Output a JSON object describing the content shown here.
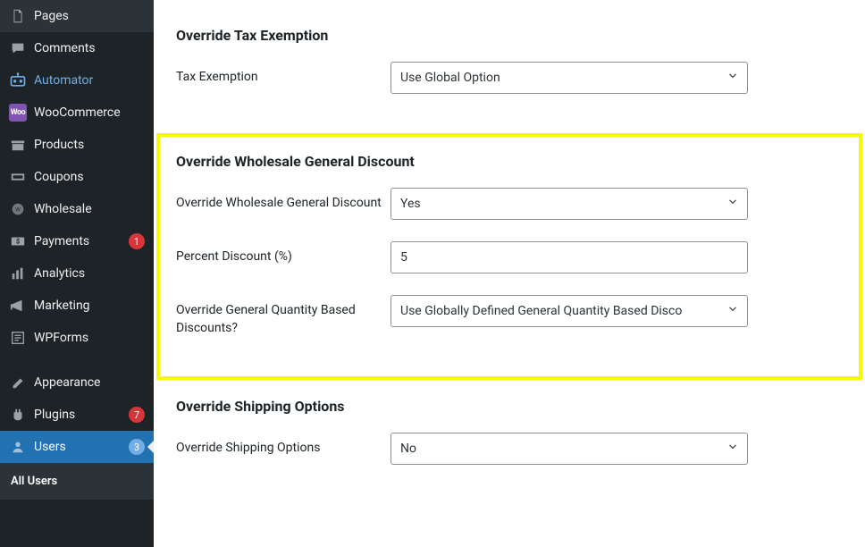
{
  "sidebar": {
    "items": [
      {
        "label": "Pages",
        "icon": "page"
      },
      {
        "label": "Comments",
        "icon": "comment"
      },
      {
        "label": "Automator",
        "icon": "automator",
        "highlight": true
      },
      {
        "label": "WooCommerce",
        "icon": "woo",
        "woo": true
      },
      {
        "label": "Products",
        "icon": "products"
      },
      {
        "label": "Coupons",
        "icon": "coupons"
      },
      {
        "label": "Wholesale",
        "icon": "wholesale"
      },
      {
        "label": "Payments",
        "icon": "payments",
        "badge": "1",
        "badgeColor": "red"
      },
      {
        "label": "Analytics",
        "icon": "analytics"
      },
      {
        "label": "Marketing",
        "icon": "marketing"
      },
      {
        "label": "WPForms",
        "icon": "wpforms"
      },
      {
        "label": "Appearance",
        "icon": "appearance"
      },
      {
        "label": "Plugins",
        "icon": "plugins",
        "badge": "7",
        "badgeColor": "red"
      },
      {
        "label": "Users",
        "icon": "users",
        "badge": "3",
        "badgeColor": "blue",
        "active": true
      }
    ],
    "submenu": {
      "items": [
        {
          "label": "All Users"
        }
      ]
    }
  },
  "sections": {
    "tax": {
      "title": "Override Tax Exemption",
      "fields": {
        "exemption": {
          "label": "Tax Exemption",
          "value": "Use Global Option"
        }
      }
    },
    "discount": {
      "title": "Override Wholesale General Discount",
      "fields": {
        "override": {
          "label": "Override Wholesale General Discount",
          "value": "Yes"
        },
        "percent": {
          "label": "Percent Discount (%)",
          "value": "5"
        },
        "quantity": {
          "label": "Override General Quantity Based Discounts?",
          "value": "Use Globally Defined General Quantity Based Disco"
        }
      }
    },
    "shipping": {
      "title": "Override Shipping Options",
      "fields": {
        "override": {
          "label": "Override Shipping Options",
          "value": "No"
        }
      }
    }
  }
}
